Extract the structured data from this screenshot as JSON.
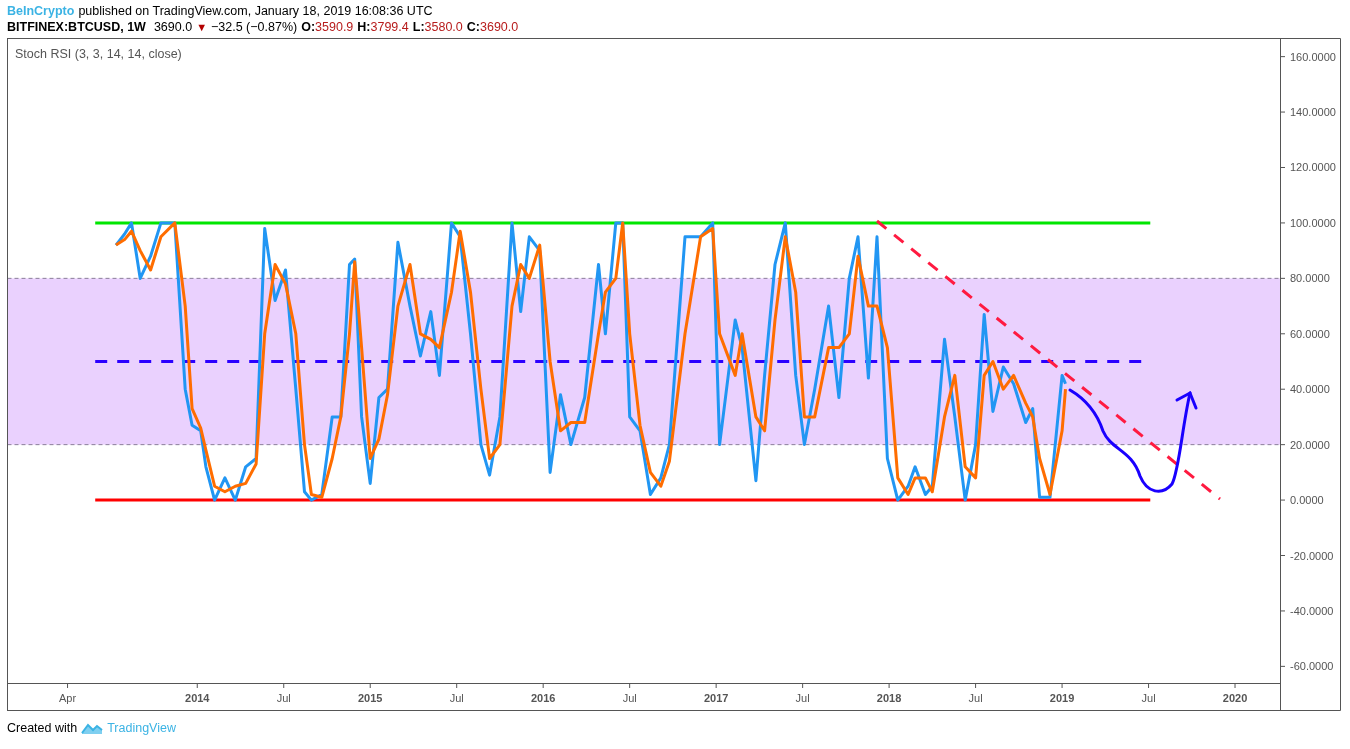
{
  "header": {
    "author": "BeInCrypto",
    "published": "published on TradingView.com, January 18, 2019 16:08:36 UTC",
    "symbol": "BITFINEX:BTCUSD, 1W",
    "price": "3690.0",
    "direction_mark": "▼",
    "change": "−32.5 (−0.87%)",
    "ohlc": [
      {
        "label": "O:",
        "value": "3590.9"
      },
      {
        "label": "H:",
        "value": "3799.4"
      },
      {
        "label": "L:",
        "value": "3580.0"
      },
      {
        "label": "C:",
        "value": "3690.0"
      }
    ]
  },
  "chart": {
    "chart_data": {
      "type": "line",
      "title": "Stoch RSI (3, 3, 14, 14, close)",
      "x": [
        2013.53,
        2013.58,
        2013.62,
        2013.67,
        2013.73,
        2013.79,
        2013.87,
        2013.93,
        2013.97,
        2014.02,
        2014.05,
        2014.1,
        2014.16,
        2014.22,
        2014.28,
        2014.34,
        2014.39,
        2014.45,
        2014.51,
        2014.57,
        2014.62,
        2014.66,
        2014.72,
        2014.78,
        2014.83,
        2014.88,
        2014.91,
        2014.95,
        2015.0,
        2015.05,
        2015.1,
        2015.16,
        2015.23,
        2015.29,
        2015.35,
        2015.4,
        2015.47,
        2015.52,
        2015.58,
        2015.64,
        2015.69,
        2015.75,
        2015.82,
        2015.87,
        2015.92,
        2015.98,
        2016.04,
        2016.1,
        2016.16,
        2016.24,
        2016.32,
        2016.36,
        2016.42,
        2016.46,
        2016.5,
        2016.56,
        2016.62,
        2016.68,
        2016.73,
        2016.82,
        2016.91,
        2016.98,
        2017.02,
        2017.11,
        2017.15,
        2017.23,
        2017.28,
        2017.34,
        2017.4,
        2017.46,
        2017.51,
        2017.57,
        2017.65,
        2017.71,
        2017.77,
        2017.82,
        2017.88,
        2017.93,
        2017.99,
        2018.05,
        2018.11,
        2018.15,
        2018.21,
        2018.25,
        2018.32,
        2018.38,
        2018.44,
        2018.5,
        2018.55,
        2018.6,
        2018.66,
        2018.72,
        2018.79,
        2018.83,
        2018.87,
        2018.93,
        2019.0,
        2019.02
      ],
      "series": [
        {
          "color": "#2196f3",
          "values": [
            92,
            96,
            100,
            80,
            88,
            100,
            100,
            40,
            27,
            25,
            12,
            0,
            8,
            0,
            12,
            15,
            98,
            72,
            83,
            40,
            3,
            0,
            2,
            30,
            30,
            85,
            87,
            30,
            6,
            37,
            40,
            93,
            70,
            52,
            68,
            45,
            100,
            95,
            60,
            20,
            9,
            30,
            100,
            68,
            95,
            90,
            10,
            38,
            20,
            37,
            85,
            60,
            100,
            100,
            30,
            25,
            2,
            8,
            20,
            95,
            95,
            100,
            20,
            65,
            55,
            7,
            45,
            85,
            100,
            45,
            20,
            40,
            70,
            37,
            80,
            95,
            44,
            95,
            15,
            0,
            5,
            12,
            2,
            5,
            58,
            30,
            0,
            20,
            67,
            32,
            48,
            42,
            28,
            33,
            1,
            1,
            45,
            42
          ]
        },
        {
          "color": "#ff6d00",
          "values": [
            92,
            94,
            97,
            90,
            83,
            95,
            100,
            70,
            33,
            26,
            18,
            5,
            3,
            5,
            6,
            13,
            60,
            85,
            78,
            60,
            20,
            2,
            1,
            15,
            30,
            60,
            86,
            55,
            15,
            22,
            38,
            70,
            85,
            60,
            58,
            55,
            75,
            97,
            75,
            40,
            15,
            20,
            70,
            85,
            80,
            92,
            50,
            25,
            28,
            28,
            60,
            75,
            80,
            100,
            60,
            27,
            10,
            5,
            14,
            60,
            95,
            98,
            60,
            45,
            60,
            30,
            25,
            65,
            95,
            75,
            30,
            30,
            55,
            55,
            60,
            88,
            70,
            70,
            55,
            8,
            2,
            8,
            8,
            3,
            30,
            45,
            12,
            8,
            45,
            50,
            40,
            45,
            35,
            30,
            15,
            2,
            25,
            40
          ]
        }
      ],
      "xlim": [
        2012.9,
        2020.26
      ],
      "ylim": [
        -66,
        166
      ],
      "xticks": [
        {
          "value": 2013.25,
          "label": "Apr"
        },
        {
          "value": 2014,
          "label": "2014"
        },
        {
          "value": 2014.5,
          "label": "Jul"
        },
        {
          "value": 2015,
          "label": "2015"
        },
        {
          "value": 2015.5,
          "label": "Jul"
        },
        {
          "value": 2016,
          "label": "2016"
        },
        {
          "value": 2016.5,
          "label": "Jul"
        },
        {
          "value": 2017,
          "label": "2017"
        },
        {
          "value": 2017.5,
          "label": "Jul"
        },
        {
          "value": 2018,
          "label": "2018"
        },
        {
          "value": 2018.5,
          "label": "Jul"
        },
        {
          "value": 2019,
          "label": "2019"
        },
        {
          "value": 2019.5,
          "label": "Jul"
        },
        {
          "value": 2020,
          "label": "2020"
        }
      ],
      "yticks": [
        {
          "value": -60,
          "label": "-60.0000"
        },
        {
          "value": -40,
          "label": "-40.0000"
        },
        {
          "value": -20,
          "label": "-20.0000"
        },
        {
          "value": 0,
          "label": "0.0000"
        },
        {
          "value": 20,
          "label": "20.0000"
        },
        {
          "value": 40,
          "label": "40.0000"
        },
        {
          "value": 60,
          "label": "60.0000"
        },
        {
          "value": 80,
          "label": "80.0000"
        },
        {
          "value": 100,
          "label": "100.0000"
        },
        {
          "value": 120,
          "label": "120.0000"
        },
        {
          "value": 140,
          "label": "140.0000"
        },
        {
          "value": 160,
          "label": "160.0000"
        }
      ],
      "bands": [
        {
          "axis": "y",
          "from": 20,
          "to": 80,
          "color": "#ead1fe"
        }
      ],
      "ref_lines": [
        {
          "axis": "y",
          "value": 100,
          "color": "#00e600"
        },
        {
          "axis": "y",
          "value": 0,
          "color": "#ff0000"
        },
        {
          "axis": "y",
          "value": 50,
          "color": "#2b00ff"
        }
      ]
    }
  },
  "footer": {
    "created_with": "Created with",
    "brand": "TradingView"
  }
}
